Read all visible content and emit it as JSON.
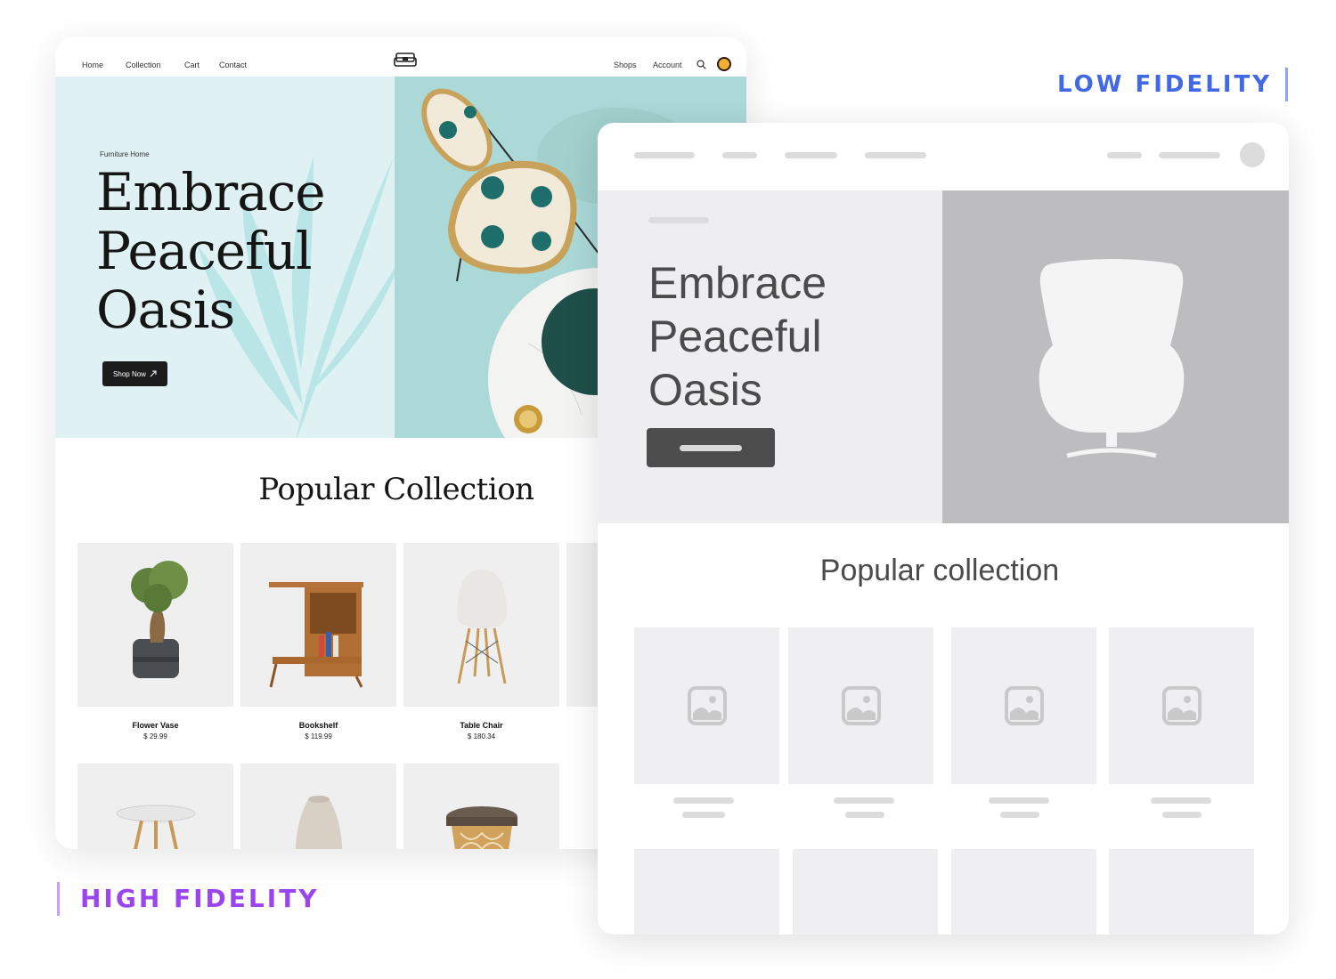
{
  "high_fidelity": {
    "label": "HIGH FIDELITY",
    "nav": {
      "links": [
        "Home",
        "Collection",
        "Cart",
        "Contact"
      ],
      "right_links": [
        "Shops",
        "Account"
      ],
      "logo_icon": "sofa-icon",
      "search_icon": "search-icon"
    },
    "hero": {
      "eyebrow": "Furniture Home",
      "title_lines": [
        "Embrace",
        "Peaceful",
        "Oasis"
      ],
      "cta": "Shop Now",
      "cta_icon": "arrow-up-right-icon"
    },
    "section_title": "Popular Collection",
    "products": [
      {
        "name": "Flower Vase",
        "price": "$ 29.99"
      },
      {
        "name": "Bookshelf",
        "price": "$ 119.99"
      },
      {
        "name": "Table Chair",
        "price": "$ 180.34"
      }
    ],
    "colors": {
      "hero_bg": "#dff1f3",
      "accent": "#aad9d8",
      "label": "#9b45f0"
    }
  },
  "low_fidelity": {
    "label": "LOW FIDELITY",
    "hero": {
      "title_lines": [
        "Embrace",
        "Peaceful",
        "Oasis"
      ],
      "image_icon": "egg-chair-icon"
    },
    "section_title": "Popular collection",
    "product_icon": "image-placeholder-icon",
    "colors": {
      "placeholder": "#dcdcdc",
      "hero_image_bg": "#bdbdbf",
      "label": "#4169e6"
    }
  }
}
